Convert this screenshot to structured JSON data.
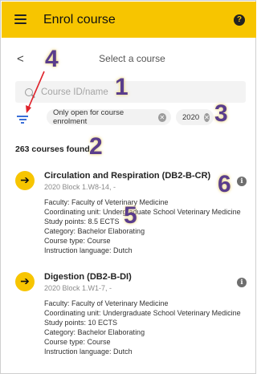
{
  "app": {
    "title": "Enrol course",
    "help_glyph": "?"
  },
  "subheader": {
    "title": "Select a course",
    "back_glyph": "<"
  },
  "search": {
    "placeholder": "Course ID/name",
    "value": ""
  },
  "filters": [
    {
      "label": "Only open for course enrolment"
    },
    {
      "label": "2020"
    }
  ],
  "results_count": "263 courses found",
  "courses": [
    {
      "title": "Circulation and Respiration (DB2-B-CR)",
      "subtitle": "2020 Block 1.W8-14, -",
      "details": [
        "Faculty: Faculty of Veterinary Medicine",
        "Coordinating unit: Undergraduate School Veterinary Medicine",
        "Study points: 8.5 ECTS",
        "Category: Bachelor Elaborating",
        "Course type: Course",
        "Instruction language: Dutch"
      ]
    },
    {
      "title": "Digestion (DB2-B-DI)",
      "subtitle": "2020 Block 1.W1-7, -",
      "details": [
        "Faculty: Faculty of Veterinary Medicine",
        "Coordinating unit: Undergraduate School Veterinary Medicine",
        "Study points: 10 ECTS",
        "Category: Bachelor Elaborating",
        "Course type: Course",
        "Instruction language: Dutch"
      ]
    }
  ],
  "annotations": [
    "1",
    "2",
    "3",
    "4",
    "5",
    "6"
  ],
  "icons": {
    "menu": "menu-icon",
    "help": "help-icon",
    "back": "chevron-left-icon",
    "search": "search-icon",
    "filter": "filter-icon",
    "chip_remove": "close-circle-icon",
    "course_go": "arrow-right-icon",
    "course_info": "info-icon"
  },
  "colors": {
    "accent": "#f7c500",
    "annotation": "#5a3d8c",
    "filter_icon": "#3a6fd8",
    "arrow": "#e0222a"
  }
}
